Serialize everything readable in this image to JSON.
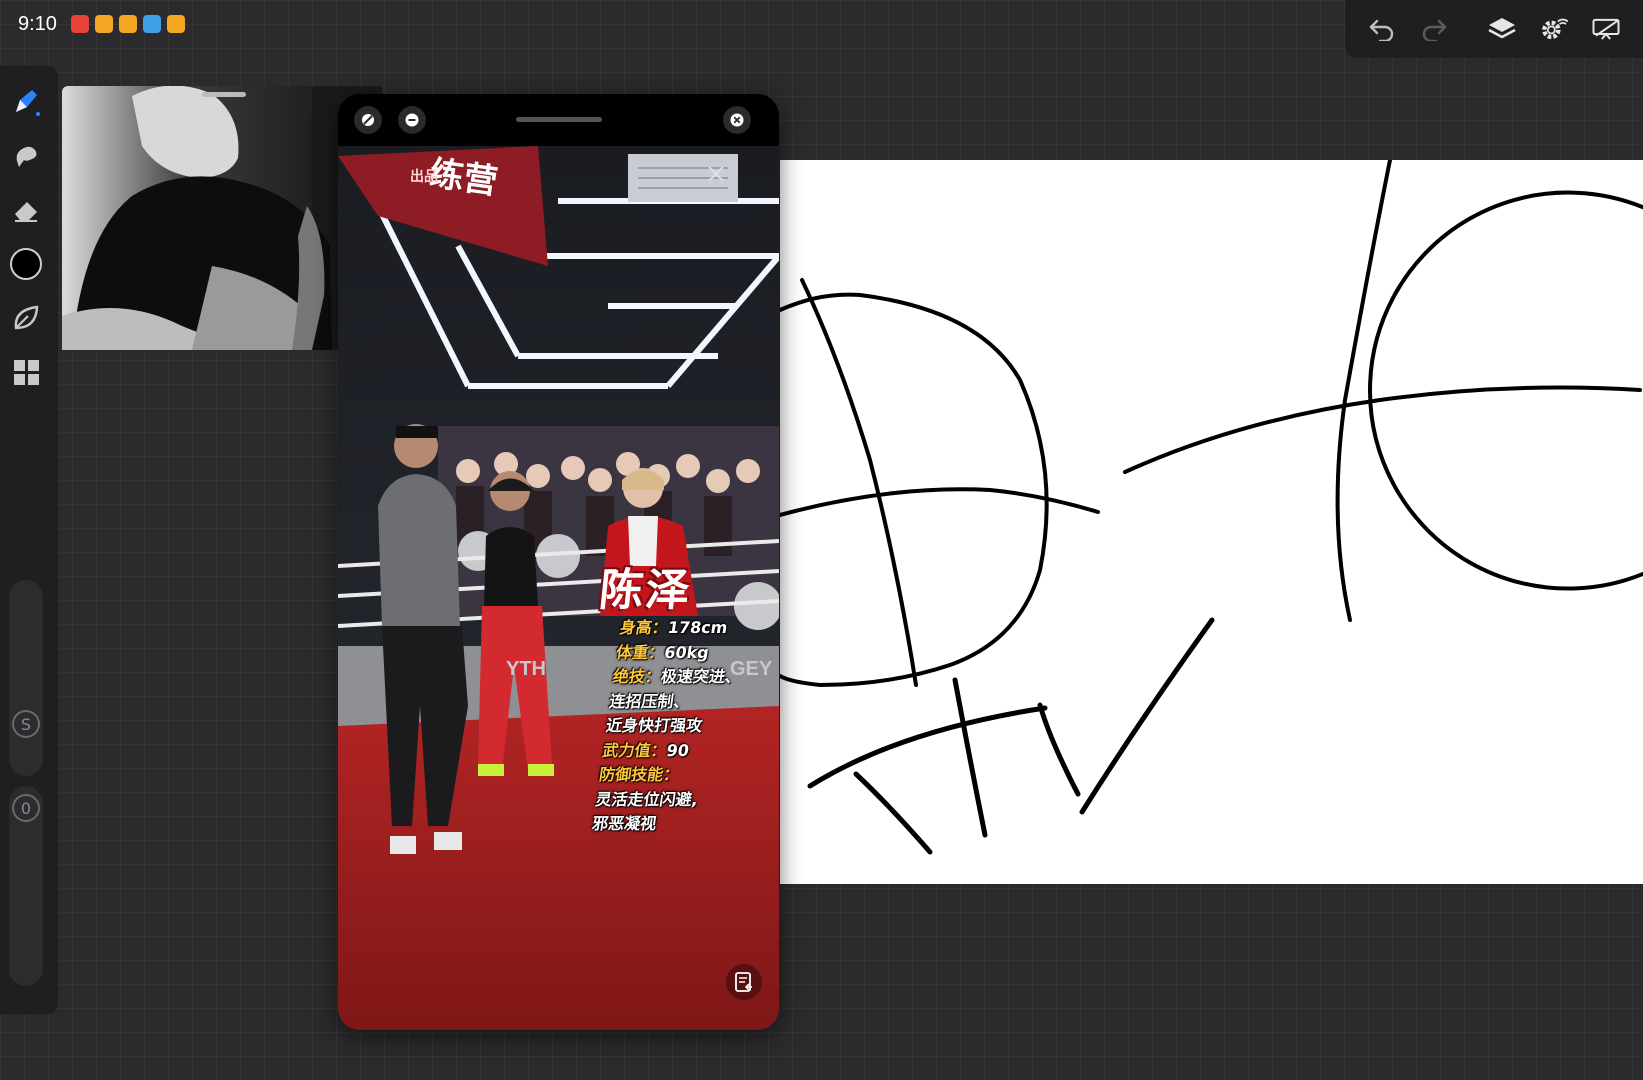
{
  "status_bar": {
    "time": "9:10",
    "notifications": [
      "app-notification-icon",
      "weibo-icon",
      "weibo-icon",
      "browser-icon",
      "weibo-icon"
    ]
  },
  "top_toolbar": {
    "buttons": [
      "undo-icon",
      "redo-icon",
      "layers-icon",
      "settings-icon",
      "display-icon"
    ]
  },
  "left_toolbar": {
    "tools": [
      "brush-icon",
      "smudge-icon",
      "eraser-icon",
      "color-picker",
      "leaf-icon",
      "grid-icon"
    ],
    "active_color": "#000000",
    "size_slider_label": "S",
    "opacity_slider_label": "0"
  },
  "floating_window": {
    "buttons": [
      "expand-icon",
      "minimize-icon",
      "close-icon"
    ],
    "video": {
      "banner_text": "练营",
      "banner_small": "出品",
      "backdrop_text_1": "YTH",
      "backdrop_text_2": "GEY",
      "caption_name": "陈泽",
      "caption_lines": [
        {
          "key": "身高",
          "val": "178cm"
        },
        {
          "key": "体重",
          "val": "60kg"
        },
        {
          "key": "绝技",
          "val": "极速突进、"
        },
        {
          "key": "",
          "val": "连招压制、"
        },
        {
          "key": "",
          "val": "近身快打强攻"
        },
        {
          "key": "武力值",
          "val": "90"
        },
        {
          "key": "防御技能",
          "val": ""
        },
        {
          "key": "",
          "val": "灵活走位闪避,"
        },
        {
          "key": "",
          "val": "邪恶凝视"
        }
      ]
    }
  },
  "colors": {
    "ui_panel": "#1f1f21",
    "canvas_bg": "#2b2b2d",
    "active_tool": "#2f80ff",
    "caption_accent": "#ffc83a",
    "caption_red": "#c0141b"
  }
}
